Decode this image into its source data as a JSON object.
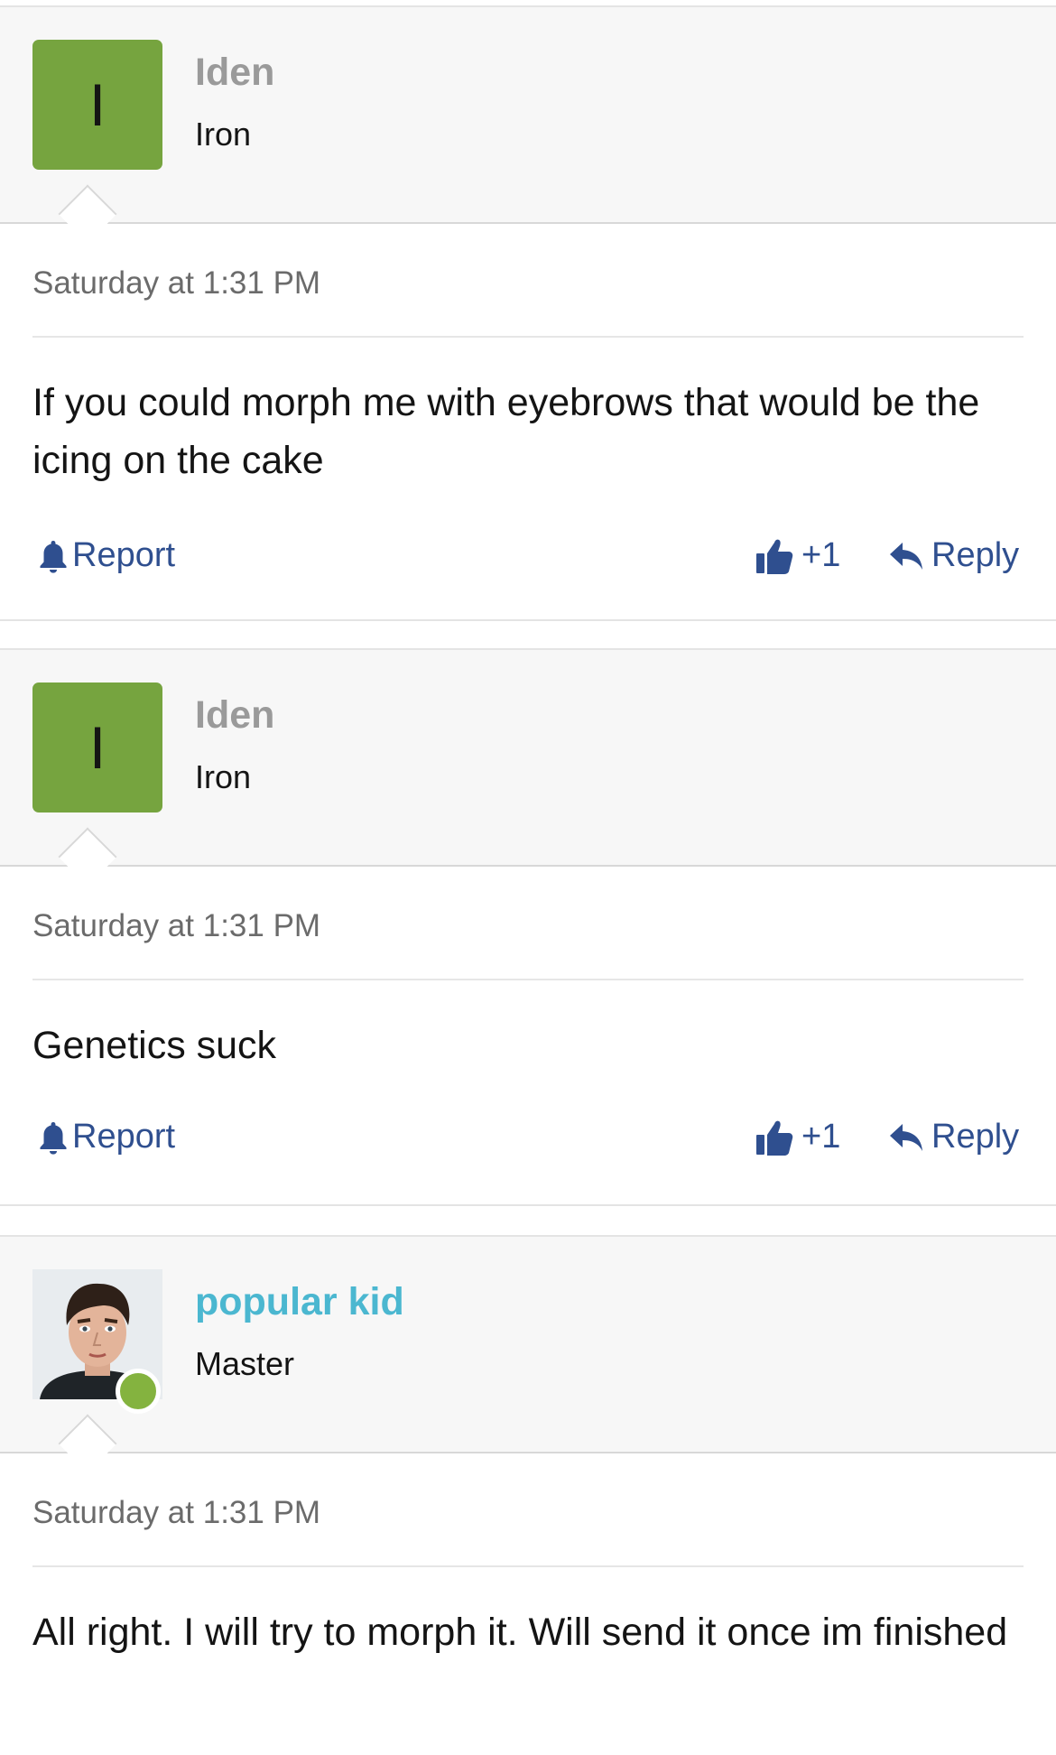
{
  "posts": [
    {
      "username": "Iden",
      "avatar_letter": "I",
      "rank": "Iron",
      "timestamp": "Saturday at 1:31 PM",
      "message": "If you could morph me with eyebrows that would be the icing on the cake",
      "report_label": "Report",
      "like_label": "+1",
      "reply_label": "Reply"
    },
    {
      "username": "Iden",
      "avatar_letter": "I",
      "rank": "Iron",
      "timestamp": "Saturday at 1:31 PM",
      "message": "Genetics suck",
      "report_label": "Report",
      "like_label": "+1",
      "reply_label": "Reply"
    },
    {
      "username": "popular kid",
      "rank": "Master",
      "timestamp": "Saturday at 1:31 PM",
      "message": "All right. I will try to morph it. Will send it once im finished"
    }
  ],
  "colors": {
    "avatar_green": "#76a43f",
    "online_dot": "#84b33f",
    "link_blue": "#2f4f8f",
    "highlight_username": "#4bb7d0"
  },
  "icons": [
    "bell-icon",
    "thumbs-up-icon",
    "reply-arrow-icon"
  ]
}
